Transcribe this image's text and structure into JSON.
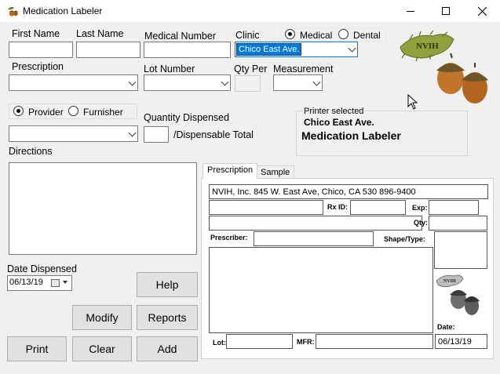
{
  "window": {
    "title": "Medication Labeler",
    "icon": "acorn-icon",
    "controls": [
      "minimize-icon",
      "maximize-icon",
      "close-icon"
    ]
  },
  "form": {
    "first_name_label": "First Name",
    "last_name_label": "Last Name",
    "medical_number_label": "Medical Number",
    "clinic_label": "Clinic",
    "clinic_radio_medical": "Medical",
    "clinic_radio_dental": "Dental",
    "clinic_selected": "Medical",
    "clinic_value": "Chico East Ave.",
    "prescription_label": "Prescription",
    "lot_number_label": "Lot Number",
    "qty_per_label": "Qty Per",
    "measurement_label": "Measurement",
    "provider_radio": "Provider",
    "furnisher_radio": "Furnisher",
    "role_selected": "Provider",
    "quantity_dispensed_label": "Quantity Dispensed",
    "dispensable_total_label": "/Dispensable Total",
    "directions_label": "Directions",
    "date_dispensed_label": "Date Dispensed",
    "date_dispensed_value": "06/13/19"
  },
  "printer": {
    "caption": "Printer selected",
    "location": "Chico East Ave.",
    "name": "Medication Labeler"
  },
  "logo": {
    "text": "NVIH"
  },
  "tabs": [
    {
      "label": "Prescription",
      "active": true
    },
    {
      "label": "Sample",
      "active": false
    }
  ],
  "label_preview": {
    "header": "NVIH, Inc. 845 W. East Ave, Chico, CA 530 896-9400",
    "rx_id_label": "Rx ID:",
    "exp_label": "Exp:",
    "qty_label": "Qty:",
    "prescriber_label": "Prescriber:",
    "shape_type_label": "Shape/Type:",
    "date_label": "Date:",
    "date_value": "06/13/19",
    "lot_label": "Lot:",
    "mfr_label": "MFR:",
    "logo_text": "NVIH"
  },
  "buttons": {
    "help": "Help",
    "modify": "Modify",
    "reports": "Reports",
    "print": "Print",
    "clear": "Clear",
    "add": "Add"
  }
}
